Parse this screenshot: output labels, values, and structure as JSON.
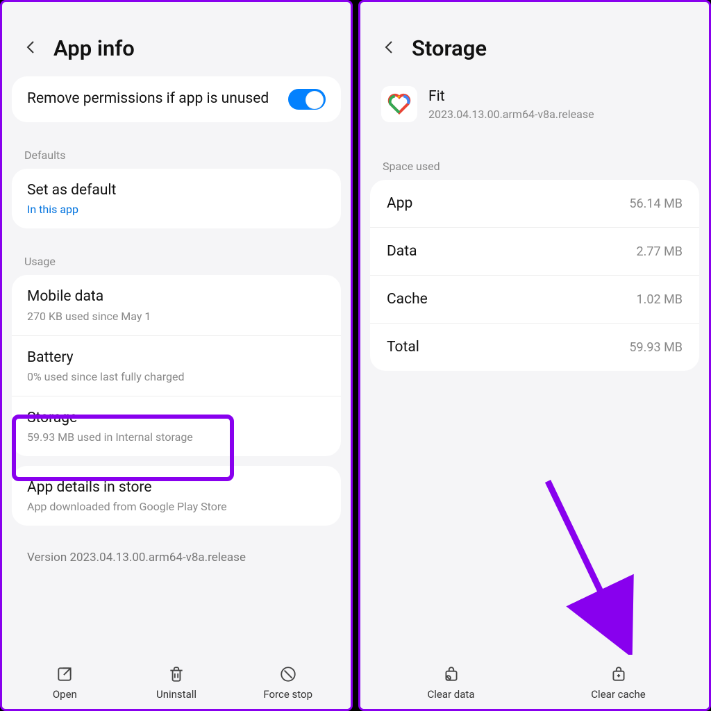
{
  "left": {
    "title": "App info",
    "permissions_row": {
      "title": "Remove permissions if app is unused"
    },
    "defaults": {
      "section": "Defaults",
      "title": "Set as default",
      "sub": "In this app"
    },
    "usage": {
      "section": "Usage",
      "mobile": {
        "title": "Mobile data",
        "sub": "270 KB used since May 1"
      },
      "battery": {
        "title": "Battery",
        "sub": "0% used since last fully charged"
      },
      "storage": {
        "title": "Storage",
        "sub": "59.93 MB used in Internal storage"
      }
    },
    "details": {
      "title": "App details in store",
      "sub": "App downloaded from Google Play Store"
    },
    "version": "Version 2023.04.13.00.arm64-v8a.release",
    "bottom": {
      "open": "Open",
      "uninstall": "Uninstall",
      "force_stop": "Force stop"
    }
  },
  "right": {
    "title": "Storage",
    "app_name": "Fit",
    "app_version": "2023.04.13.00.arm64-v8a.release",
    "section": "Space used",
    "rows": {
      "app": {
        "label": "App",
        "value": "56.14 MB"
      },
      "data": {
        "label": "Data",
        "value": "2.77 MB"
      },
      "cache": {
        "label": "Cache",
        "value": "1.02 MB"
      },
      "total": {
        "label": "Total",
        "value": "59.93 MB"
      }
    },
    "bottom": {
      "clear_data": "Clear data",
      "clear_cache": "Clear cache"
    }
  }
}
